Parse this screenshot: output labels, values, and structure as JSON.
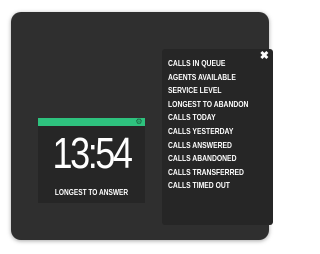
{
  "widget": {
    "gear_icon": "gear-icon",
    "accent_color": "#2ec27e",
    "value": "13:54",
    "label": "LONGEST TO ANSWER"
  },
  "menu": {
    "close_label": "✖",
    "items": [
      {
        "label": "CALLS IN QUEUE"
      },
      {
        "label": "AGENTS AVAILABLE"
      },
      {
        "label": "SERVICE LEVEL"
      },
      {
        "label": "LONGEST TO ABANDON"
      },
      {
        "label": "CALLS TODAY"
      },
      {
        "label": "CALLS YESTERDAY"
      },
      {
        "label": "CALLS ANSWERED"
      },
      {
        "label": "CALLS ABANDONED"
      },
      {
        "label": "CALLS TRANSFERRED"
      },
      {
        "label": "CALLS TIMED OUT"
      }
    ]
  }
}
